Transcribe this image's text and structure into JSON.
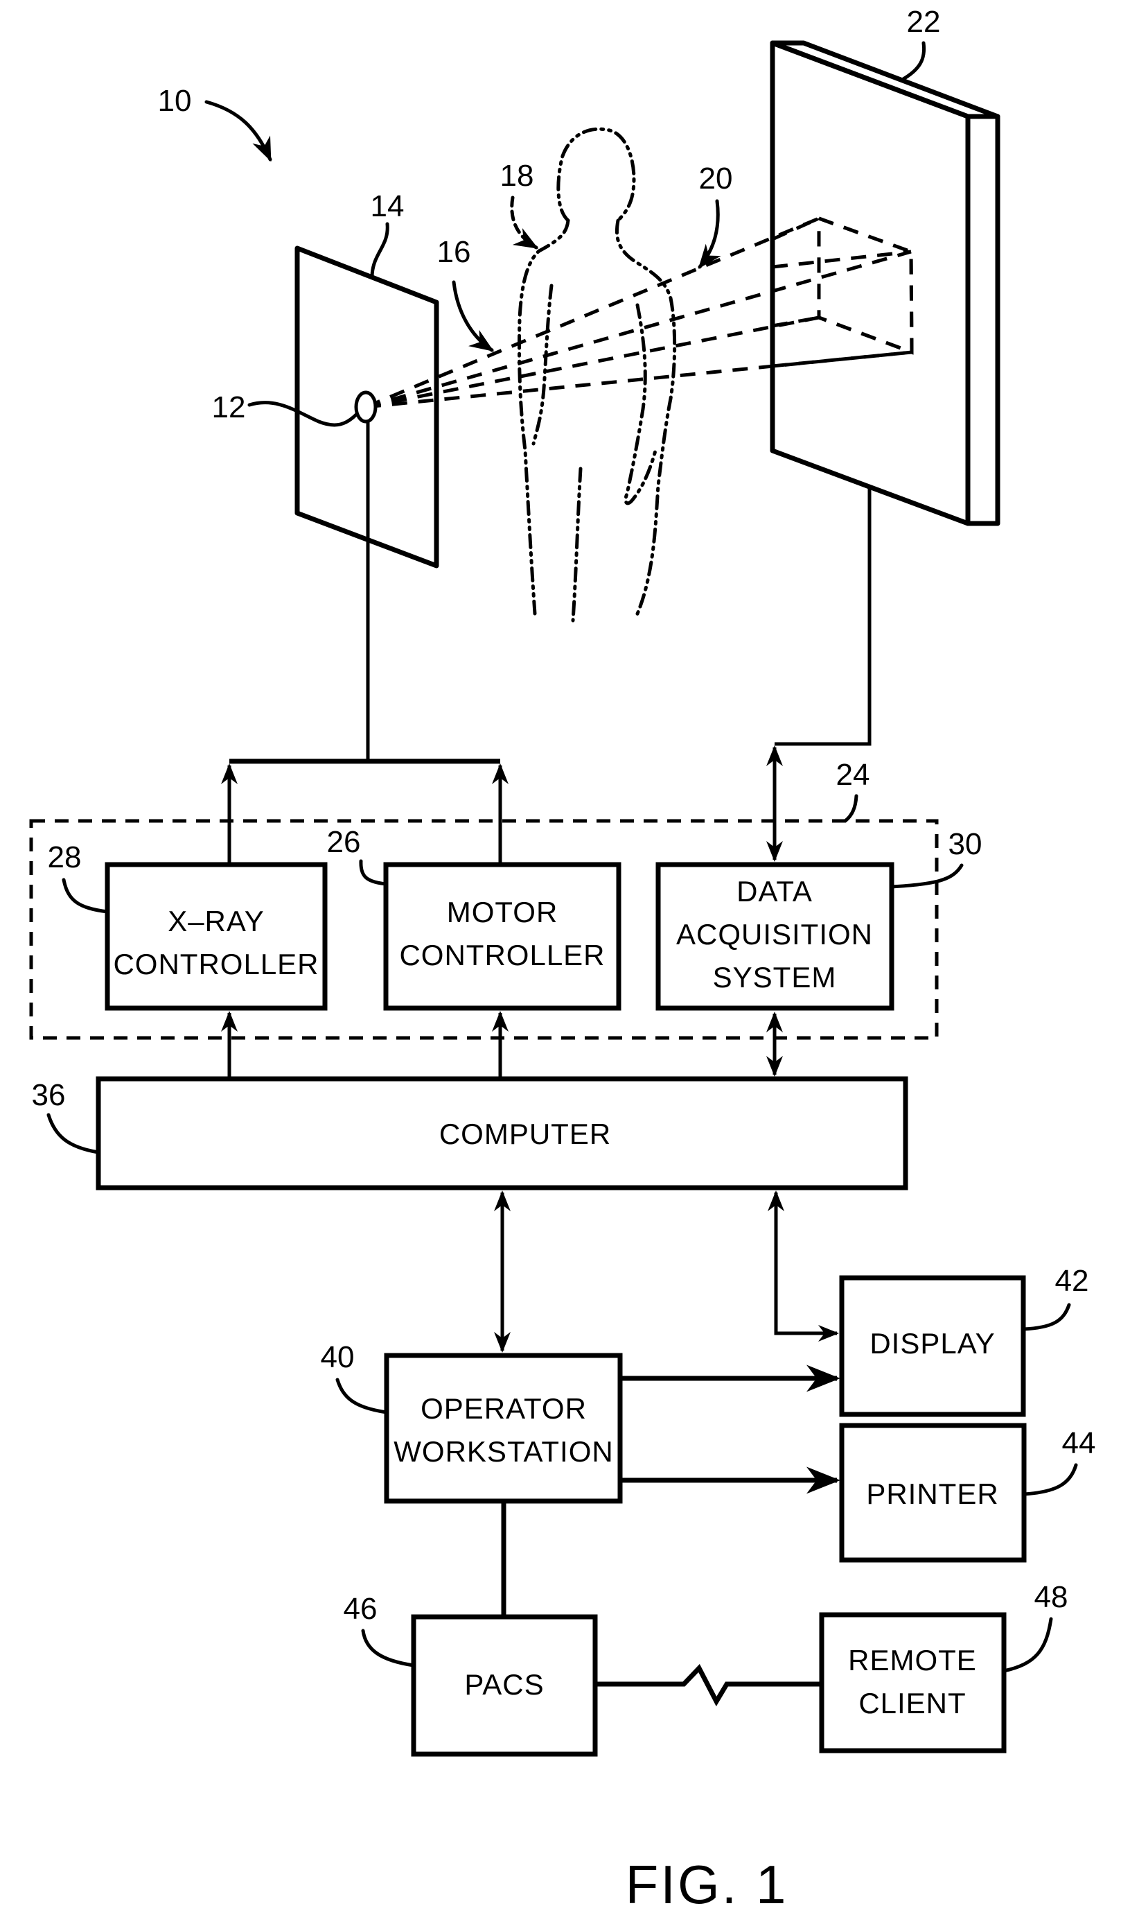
{
  "figure": {
    "caption": "FIG. 1",
    "system_ref": "10"
  },
  "refs": {
    "source": "12",
    "collimator": "14",
    "xray_beam": "16",
    "patient": "18",
    "attenuated_beam": "20",
    "detector": "22",
    "control_mechanism": "24",
    "motor_controller": "26",
    "xray_controller": "28",
    "das": "30",
    "computer": "36",
    "operator_workstation": "40",
    "display": "42",
    "printer": "44",
    "pacs": "46",
    "remote_client": "48"
  },
  "blocks": {
    "xray_controller": [
      "X–RAY",
      "CONTROLLER"
    ],
    "motor_controller": [
      "MOTOR",
      "CONTROLLER"
    ],
    "das": [
      "DATA",
      "ACQUISITION",
      "SYSTEM"
    ],
    "computer": [
      "COMPUTER"
    ],
    "operator_workstation": [
      "OPERATOR",
      "WORKSTATION"
    ],
    "display": [
      "DISPLAY"
    ],
    "printer": [
      "PRINTER"
    ],
    "pacs": [
      "PACS"
    ],
    "remote_client": [
      "REMOTE",
      "CLIENT"
    ]
  }
}
